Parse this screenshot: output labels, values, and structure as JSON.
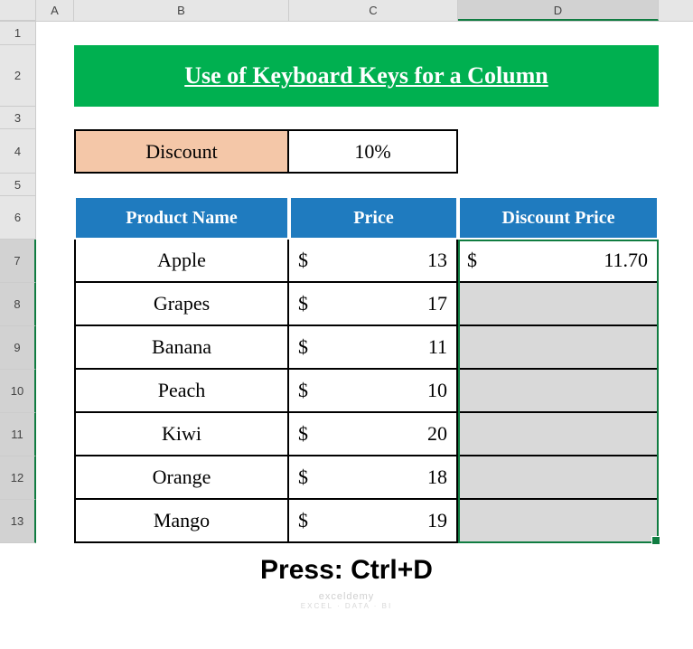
{
  "columns": [
    "A",
    "B",
    "C",
    "D"
  ],
  "rows": [
    "1",
    "2",
    "3",
    "4",
    "5",
    "6",
    "7",
    "8",
    "9",
    "10",
    "11",
    "12",
    "13"
  ],
  "title": "Use of Keyboard Keys for a Column",
  "discount": {
    "label": "Discount",
    "value": "10%"
  },
  "headers": {
    "product": "Product Name",
    "price": "Price",
    "discount_price": "Discount Price"
  },
  "currency": "$",
  "products": [
    {
      "name": "Apple",
      "price": "13",
      "discount": "11.70"
    },
    {
      "name": "Grapes",
      "price": "17",
      "discount": ""
    },
    {
      "name": "Banana",
      "price": "11",
      "discount": ""
    },
    {
      "name": "Peach",
      "price": "10",
      "discount": ""
    },
    {
      "name": "Kiwi",
      "price": "20",
      "discount": ""
    },
    {
      "name": "Orange",
      "price": "18",
      "discount": ""
    },
    {
      "name": "Mango",
      "price": "19",
      "discount": ""
    }
  ],
  "instruction": "Press: Ctrl+D",
  "watermark": {
    "line1": "exceldemy",
    "line2": "EXCEL · DATA · BI"
  },
  "selection": {
    "range": "D7:D13",
    "active": "D7"
  },
  "chart_data": {
    "type": "table",
    "title": "Use of Keyboard Keys for a Column",
    "discount_rate": 0.1,
    "columns": [
      "Product Name",
      "Price",
      "Discount Price"
    ],
    "rows": [
      [
        "Apple",
        13,
        11.7
      ],
      [
        "Grapes",
        17,
        null
      ],
      [
        "Banana",
        11,
        null
      ],
      [
        "Peach",
        10,
        null
      ],
      [
        "Kiwi",
        20,
        null
      ],
      [
        "Orange",
        18,
        null
      ],
      [
        "Mango",
        19,
        null
      ]
    ]
  }
}
